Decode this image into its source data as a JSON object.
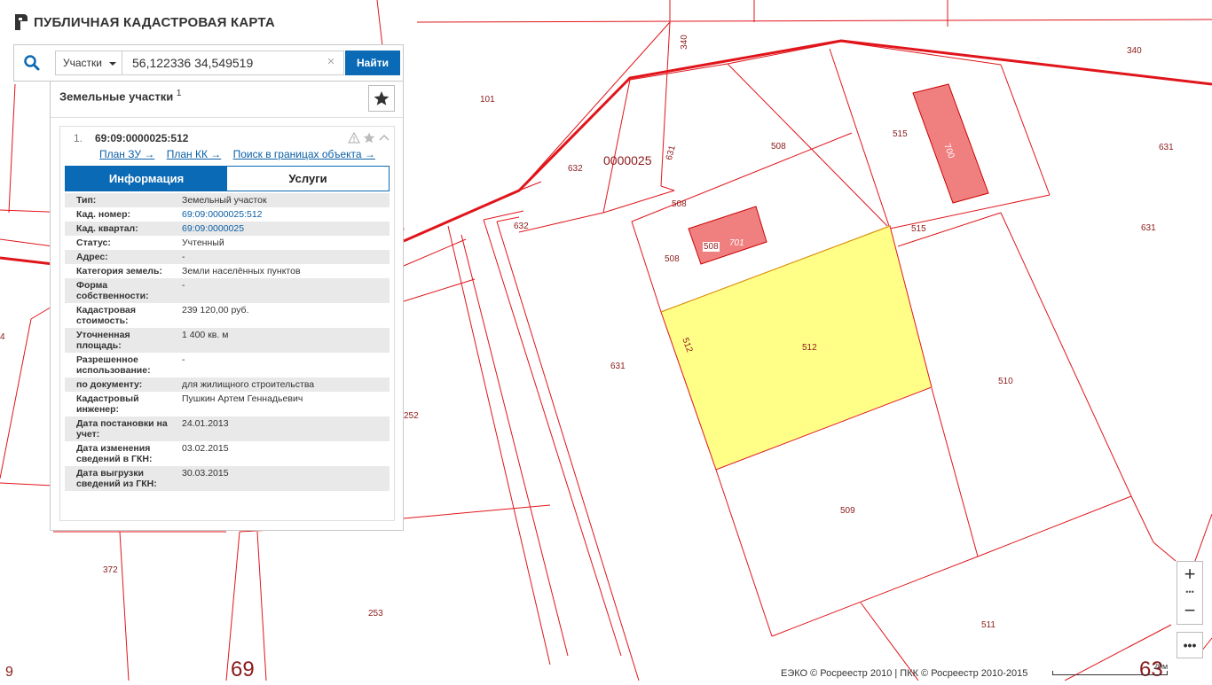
{
  "app": {
    "title": "ПУБЛИЧНАЯ КАДАСТРОВАЯ КАРТА"
  },
  "search": {
    "type_label": "Участки",
    "query": "56,122336 34,549519",
    "find_label": "Найти"
  },
  "results": {
    "heading": "Земельные участки",
    "count": "1",
    "item": {
      "index": "1.",
      "cad_number": "69:09:0000025:512",
      "links": [
        "План ЗУ →",
        "План КК →",
        "Поиск в границах объекта →"
      ],
      "tabs": {
        "info": "Информация",
        "services": "Услуги"
      },
      "fields": [
        {
          "label": "Тип:",
          "value": "Земельный участок"
        },
        {
          "label": "Кад. номер:",
          "value": "69:09:0000025:512"
        },
        {
          "label": "Кад. квартал:",
          "value": "69:09:0000025"
        },
        {
          "label": "Статус:",
          "value": "Учтенный"
        },
        {
          "label": "Адрес:",
          "value": "-"
        },
        {
          "label": "Категория земель:",
          "value": "Земли населённых пунктов"
        },
        {
          "label": "Форма собственности:",
          "value": "-"
        },
        {
          "label": "Кадастровая стоимость:",
          "value": "239 120,00 руб."
        },
        {
          "label": "Уточненная площадь:",
          "value": "1 400 кв. м"
        },
        {
          "label": "Разрешенное использование:",
          "value": "-"
        },
        {
          "label": "по документу:",
          "value": "для жилищного строительства"
        },
        {
          "label": "Кадастровый инженер:",
          "value": "Пушкин Артем Геннадьевич"
        },
        {
          "label": "Дата постановки на учет:",
          "value": "24.01.2013"
        },
        {
          "label": "Дата изменения сведений в ГКН:",
          "value": "03.02.2015"
        },
        {
          "label": "Дата выгрузки сведений из ГКН:",
          "value": "30.03.2015"
        }
      ]
    }
  },
  "map": {
    "labels": {
      "l101": "101",
      "l340a": "340",
      "l340b": "340",
      "l632a": "632",
      "l632b": "632",
      "l0000025": "0000025",
      "l631a": "631",
      "l508a": "508",
      "l508b": "508",
      "l508c": "508",
      "l508d": "508",
      "l701": "701",
      "l515a": "515",
      "l515b": "515",
      "l700": "700",
      "l631b": "631",
      "l631c": "631",
      "l631d": "631",
      "l512a": "512",
      "l512b": "512",
      "l510": "510",
      "l509": "509",
      "l511": "511",
      "l252": "252",
      "l372": "372",
      "l253": "253",
      "l69": "69",
      "l9": "9",
      "l4": "4",
      "l63": "63"
    },
    "colors": {
      "boundary": "#e0151b",
      "selected_fill": "#ffff88",
      "building_fill": "#f08080"
    }
  },
  "footer": {
    "copyright": "ЕЭКО © Росреестр 2010 | ПКК © Росреестр 2010-2015",
    "scale": "20м"
  },
  "controls": {
    "zoom_in": "+",
    "zoom_out": "−",
    "more": "•••"
  }
}
